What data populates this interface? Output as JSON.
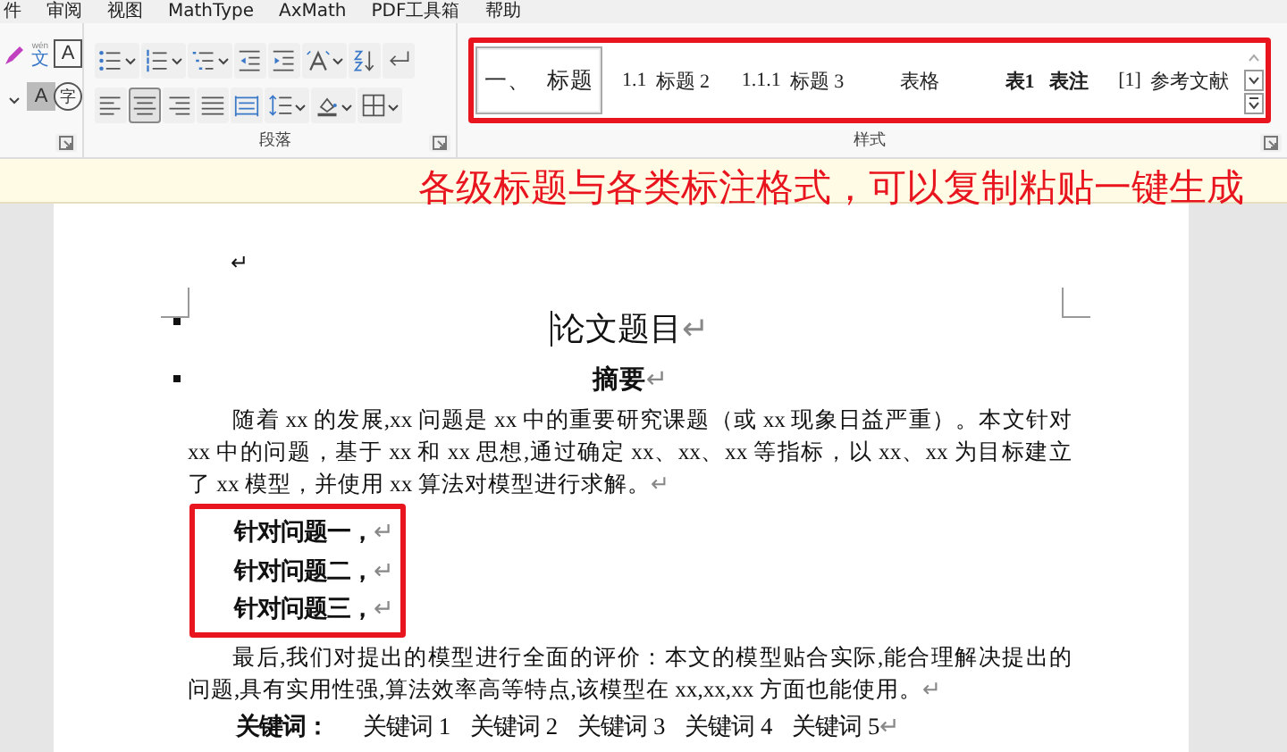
{
  "menu": [
    {
      "label": "件"
    },
    {
      "label": "审阅"
    },
    {
      "label": "视图"
    },
    {
      "label": "MathType"
    },
    {
      "label": "AxMath"
    },
    {
      "label": "PDF工具箱"
    },
    {
      "label": "帮助"
    }
  ],
  "font_group": {
    "buttons": [
      {
        "kind": "phonetic",
        "glyph": "文",
        "ruby": "wén"
      },
      {
        "kind": "boxed",
        "glyph": "A"
      },
      {
        "kind": "shaded",
        "glyph": "A"
      },
      {
        "kind": "circled",
        "glyph": "字"
      }
    ]
  },
  "paragraph_group": {
    "label": "段落",
    "alignment_buttons": [
      {
        "selected": false
      },
      {
        "selected": true
      },
      {
        "selected": false
      },
      {
        "selected": false
      },
      {
        "selected": false
      }
    ]
  },
  "styles_group": {
    "label": "样式",
    "items": [
      {
        "prefix": "一、",
        "label": "标题",
        "kind": "heading1",
        "selected": true
      },
      {
        "prefix": "1.1",
        "label": "标题 2",
        "kind": "heading",
        "selected": false
      },
      {
        "prefix": "1.1.1",
        "label": "标题 3",
        "kind": "heading",
        "selected": false
      },
      {
        "label": "表格",
        "kind": "plain",
        "selected": false
      },
      {
        "prefix": "表1",
        "label": "表注",
        "kind": "caption",
        "selected": false
      },
      {
        "prefix": "[1]",
        "label": "参考文献",
        "kind": "heading",
        "selected": false
      }
    ]
  },
  "annotation": "各级标题与各类标注格式，可以复制粘贴一键生成",
  "document": {
    "blocks": [
      {
        "kind": "empty",
        "end_mark": "↵"
      },
      {
        "kind": "title",
        "text": "论文题目",
        "end_mark": "↵"
      },
      {
        "kind": "heading",
        "text": "摘要",
        "end_mark": "↵"
      },
      {
        "kind": "body",
        "text": "随着 xx 的发展,xx 问题是 xx 中的重要研究课题（或 xx 现象日益严重）。本文针对 xx 中的问题，基于 xx 和 xx 思想,通过确定 xx、xx、xx 等指标，以 xx、xx 为目标建立了 xx 模型，并使用 xx 算法对模型进行求解。",
        "end_mark": "↵"
      },
      {
        "kind": "framed",
        "lines": [
          {
            "text": "针对问题一，",
            "end_mark": "↵"
          },
          {
            "text": "针对问题二，",
            "end_mark": "↵"
          },
          {
            "text": "针对问题三，",
            "end_mark": "↵"
          }
        ]
      },
      {
        "kind": "body",
        "text": "最后,我们对提出的模型进行全面的评价：本文的模型贴合实际,能合理解决提出的问题,具有实用性强,算法效率高等特点,该模型在 xx,xx,xx 方面也能使用。",
        "end_mark": "↵"
      },
      {
        "kind": "keywords",
        "label": "关键词：",
        "keywords": [
          "关键词 1",
          "关键词 2",
          "关键词 3",
          "关键词 4",
          "关键词 5"
        ],
        "end_mark": "↵"
      }
    ]
  }
}
